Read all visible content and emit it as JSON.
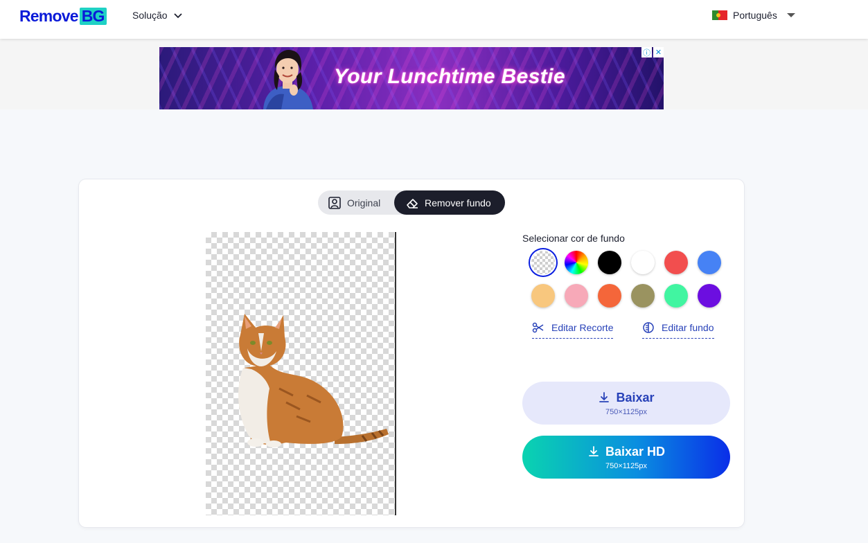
{
  "header": {
    "logo_part1": "Remove",
    "logo_part2": "BG",
    "nav_solution": "Solução",
    "language": "Português"
  },
  "ad": {
    "headline": "Your Lunchtime Bestie",
    "info_icon": "ⓘ",
    "close_icon": "✕"
  },
  "toggle": {
    "original_label": "Original",
    "remove_label": "Remover fundo",
    "active": "remove"
  },
  "background_panel": {
    "title": "Selecionar cor de fundo",
    "swatches": [
      {
        "name": "transparent",
        "color": "transparent",
        "selected": true
      },
      {
        "name": "rainbow",
        "color": "conic-rainbow"
      },
      {
        "name": "black",
        "color": "#000000"
      },
      {
        "name": "white",
        "color": "#ffffff"
      },
      {
        "name": "red",
        "color": "#f24e4e"
      },
      {
        "name": "blue",
        "color": "#4682f5"
      },
      {
        "name": "peach",
        "color": "#f8c77e"
      },
      {
        "name": "pink",
        "color": "#f7a9b8"
      },
      {
        "name": "orange",
        "color": "#f4663a"
      },
      {
        "name": "olive",
        "color": "#9a9360"
      },
      {
        "name": "mint",
        "color": "#41f5a1"
      },
      {
        "name": "violet",
        "color": "#6c0ee0"
      }
    ],
    "edit_cutout": "Editar Recorte",
    "edit_background": "Editar fundo"
  },
  "downloads": {
    "free_label": "Baixar",
    "free_size": "750×1125px",
    "hd_label": "Baixar HD",
    "hd_size": "750×1125px"
  }
}
